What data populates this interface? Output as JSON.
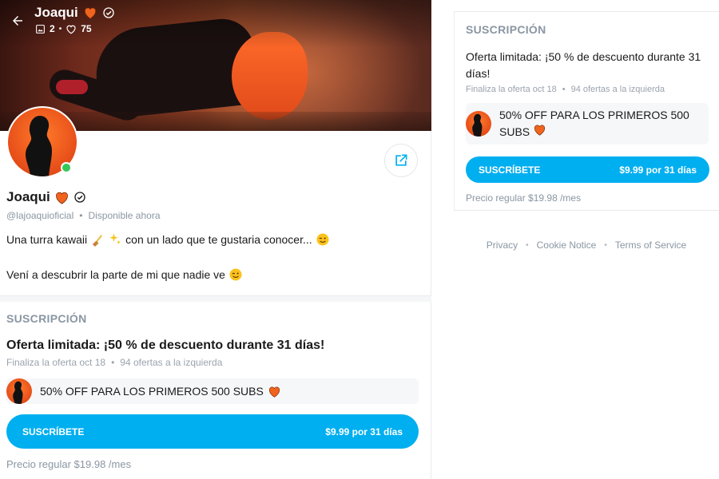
{
  "header": {
    "name": "Joaqui",
    "photos_count": "2",
    "likes_count": "75"
  },
  "profile": {
    "name": "Joaqui",
    "handle": "@lajoaquioficial",
    "status": "Disponible ahora",
    "bio_line1": "Una turra kawaii",
    "bio_line1_after": "con un lado que te gustaria conocer...",
    "bio_line2": "Vení a descubrir la parte de mi que nadie ve"
  },
  "subscription": {
    "section_title": "SUSCRIPCIÓN",
    "offer_title": "Oferta limitada: ¡50 % de descuento durante 31 días!",
    "offer_ends": "Finaliza la oferta oct 18",
    "offers_left": "94 ofertas a la izquierda",
    "promo_text": "50% OFF PARA LOS PRIMEROS 500 SUBS",
    "subscribe_label": "SUSCRÍBETE",
    "price_label": "$9.99 por 31 días",
    "regular_price": "Precio regular $19.98 /mes"
  },
  "footer": {
    "privacy": "Privacy",
    "cookie": "Cookie Notice",
    "terms": "Terms of Service"
  },
  "colors": {
    "accent": "#00aff0",
    "online": "#34c759",
    "muted": "#8a96a3",
    "heart": "#f0641e"
  },
  "icons": {
    "back": "arrow-left-icon",
    "verified": "verified-badge-icon",
    "heart": "orange-heart-icon",
    "photo": "image-icon",
    "like": "heart-outline-icon",
    "share": "share-icon"
  }
}
